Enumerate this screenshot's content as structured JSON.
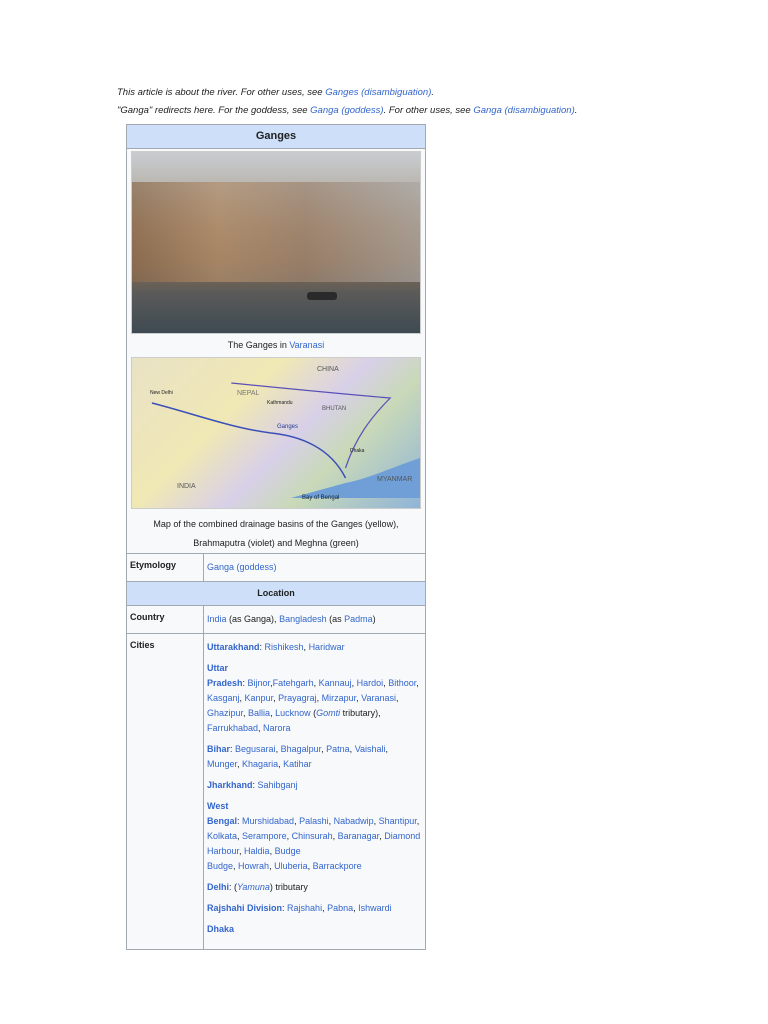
{
  "hatnotes": [
    [
      {
        "t": "This article is about the river. For other uses, see "
      },
      {
        "t": "Ganges (disambiguation)",
        "link": true
      },
      {
        "t": "."
      }
    ],
    [
      {
        "t": "\"Ganga\" redirects here. For the goddess, see "
      },
      {
        "t": "Ganga (goddess)",
        "link": true
      },
      {
        "t": ". For other uses, see "
      },
      {
        "t": "Ganga (disambiguation)",
        "link": true
      },
      {
        "t": "."
      }
    ]
  ],
  "infobox": {
    "title": "Ganges",
    "image_caption": [
      {
        "t": "The Ganges in "
      },
      {
        "t": "Varanasi",
        "link": true
      }
    ],
    "map_caption_line1": "Map of the combined drainage basins of the Ganges (yellow),",
    "map_caption_line2": "Brahmaputra (violet) and Meghna (green)",
    "map_labels": [
      "CHINA",
      "NEPAL",
      "BHUTAN",
      "INDIA",
      "MYANMAR",
      "Bay of Bengal",
      "New Delhi",
      "Ganges",
      "Kathmandu",
      "Dhaka"
    ],
    "etymology_label": "Etymology",
    "etymology": [
      {
        "t": "Ganga (goddess)",
        "link": true
      }
    ],
    "location_header": "Location",
    "country_label": "Country",
    "country": [
      {
        "t": "India",
        "link": true
      },
      {
        "t": " (as Ganga), "
      },
      {
        "t": "Bangladesh",
        "link": true
      },
      {
        "t": " (as "
      },
      {
        "t": "Padma",
        "link": true
      },
      {
        "t": ")"
      }
    ],
    "cities_label": "Cities",
    "cities": [
      [
        {
          "t": "Uttarakhand",
          "link": true,
          "bold": true
        },
        {
          "t": ": "
        },
        {
          "t": "Rishikesh",
          "link": true
        },
        {
          "t": ", "
        },
        {
          "t": "Haridwar",
          "link": true
        }
      ],
      [
        {
          "t": "Uttar",
          "link": true,
          "bold": true
        },
        {
          "br": true
        },
        {
          "t": "Pradesh",
          "link": true,
          "bold": true
        },
        {
          "t": ": "
        },
        {
          "t": "Bijnor",
          "link": true
        },
        {
          "t": ","
        },
        {
          "t": "Fatehgarh",
          "link": true
        },
        {
          "t": ", "
        },
        {
          "t": "Kannauj",
          "link": true
        },
        {
          "t": ", "
        },
        {
          "t": "Hardoi",
          "link": true
        },
        {
          "t": ", "
        },
        {
          "t": "Bithoor",
          "link": true
        },
        {
          "t": ", "
        },
        {
          "t": "Kasganj",
          "link": true
        },
        {
          "t": ", "
        },
        {
          "t": "Kanpur",
          "link": true
        },
        {
          "t": ", "
        },
        {
          "t": "Prayagraj",
          "link": true
        },
        {
          "t": ", "
        },
        {
          "t": "Mirzapur",
          "link": true
        },
        {
          "t": ", "
        },
        {
          "t": "Varanasi",
          "link": true
        },
        {
          "t": ", "
        },
        {
          "t": "Ghazipur",
          "link": true
        },
        {
          "t": ", "
        },
        {
          "t": "Ballia",
          "link": true
        },
        {
          "t": ", "
        },
        {
          "t": "Lucknow",
          "link": true
        },
        {
          "t": " ("
        },
        {
          "t": "Gomti",
          "link": true,
          "italic": true
        },
        {
          "t": " tributary), "
        },
        {
          "t": "Farrukhabad",
          "link": true
        },
        {
          "t": ", "
        },
        {
          "t": "Narora",
          "link": true
        }
      ],
      [
        {
          "t": "Bihar",
          "link": true,
          "bold": true
        },
        {
          "t": ": "
        },
        {
          "t": "Begusarai",
          "link": true
        },
        {
          "t": ", "
        },
        {
          "t": "Bhagalpur",
          "link": true
        },
        {
          "t": ", "
        },
        {
          "t": "Patna",
          "link": true
        },
        {
          "t": ", "
        },
        {
          "t": "Vaishali",
          "link": true
        },
        {
          "t": ", "
        },
        {
          "t": "Munger",
          "link": true
        },
        {
          "t": ", "
        },
        {
          "t": "Khagaria",
          "link": true
        },
        {
          "t": ", "
        },
        {
          "t": "Katihar",
          "link": true
        }
      ],
      [
        {
          "t": "Jharkhand",
          "link": true,
          "bold": true
        },
        {
          "t": ": "
        },
        {
          "t": "Sahibganj",
          "link": true
        }
      ],
      [
        {
          "t": "West",
          "link": true,
          "bold": true
        },
        {
          "br": true
        },
        {
          "t": "Bengal",
          "link": true,
          "bold": true
        },
        {
          "t": ": "
        },
        {
          "t": "Murshidabad",
          "link": true
        },
        {
          "t": ", "
        },
        {
          "t": "Palashi",
          "link": true
        },
        {
          "t": ", "
        },
        {
          "t": "Nabadwip",
          "link": true
        },
        {
          "t": ", "
        },
        {
          "t": "Shantipur",
          "link": true
        },
        {
          "t": ", "
        },
        {
          "t": "Kolkata",
          "link": true
        },
        {
          "t": ", "
        },
        {
          "t": "Serampore",
          "link": true
        },
        {
          "t": ", "
        },
        {
          "t": "Chinsurah",
          "link": true
        },
        {
          "t": ", "
        },
        {
          "t": "Baranagar",
          "link": true
        },
        {
          "t": ", "
        },
        {
          "t": "Diamond Harbour",
          "link": true
        },
        {
          "t": ", "
        },
        {
          "t": "Haldia",
          "link": true
        },
        {
          "t": ", "
        },
        {
          "t": "Budge",
          "link": true
        },
        {
          "br": true
        },
        {
          "t": "Budge",
          "link": true
        },
        {
          "t": ", "
        },
        {
          "t": "Howrah",
          "link": true
        },
        {
          "t": ", "
        },
        {
          "t": "Uluberia",
          "link": true
        },
        {
          "t": ", "
        },
        {
          "t": "Barrackpore",
          "link": true
        }
      ],
      [
        {
          "t": "Delhi",
          "link": true,
          "bold": true
        },
        {
          "t": ": ("
        },
        {
          "t": "Yamuna",
          "link": true,
          "italic": true
        },
        {
          "t": ") tributary"
        }
      ],
      [
        {
          "t": "Rajshahi Division",
          "link": true,
          "bold": true
        },
        {
          "t": ": "
        },
        {
          "t": "Rajshahi",
          "link": true
        },
        {
          "t": ", "
        },
        {
          "t": "Pabna",
          "link": true
        },
        {
          "t": ", "
        },
        {
          "t": "Ishwardi",
          "link": true
        }
      ],
      [
        {
          "t": "Dhaka",
          "link": true,
          "bold": true
        }
      ]
    ]
  }
}
